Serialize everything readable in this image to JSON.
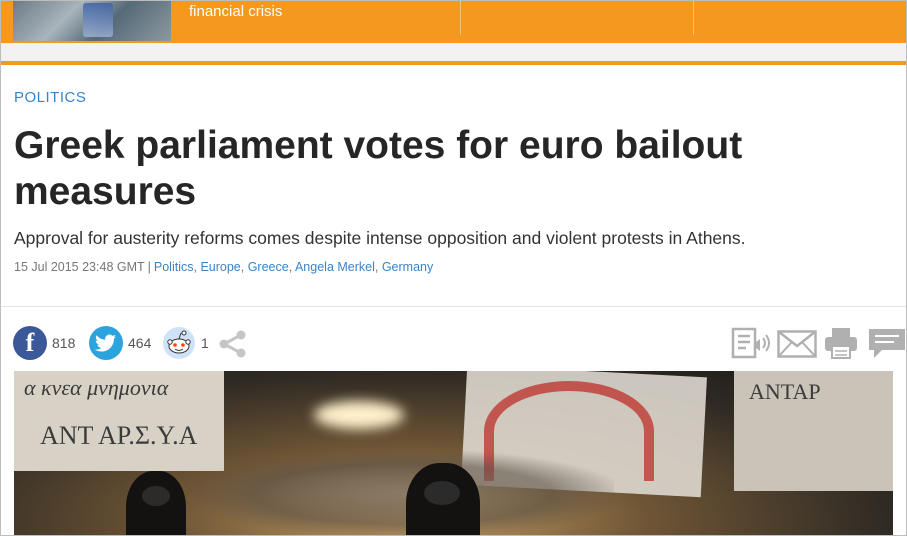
{
  "banner": {
    "text": "financial crisis"
  },
  "article": {
    "section": "POLITICS",
    "headline": "Greek parliament votes for euro bailout measures",
    "standfirst": "Approval for austerity reforms comes despite intense opposition and violent protests in Athens.",
    "timestamp": "15 Jul 2015 23:48 GMT",
    "separator": "|",
    "tags": [
      "Politics",
      "Europe",
      "Greece",
      "Angela Merkel",
      "Germany"
    ]
  },
  "share": {
    "facebook_count": "818",
    "twitter_count": "464",
    "reddit_count": "1"
  },
  "photo": {
    "banner_text_1": "α κνεα μνημονια",
    "banner_text_2": "ΑΝΤ ΑΡ.Σ.Υ.Α",
    "banner_text_3": "ΑΝΤΑΡ"
  },
  "colors": {
    "accent": "#f4991d",
    "link": "#3a84c5",
    "facebook": "#3b5998",
    "twitter": "#2ba4dd"
  }
}
